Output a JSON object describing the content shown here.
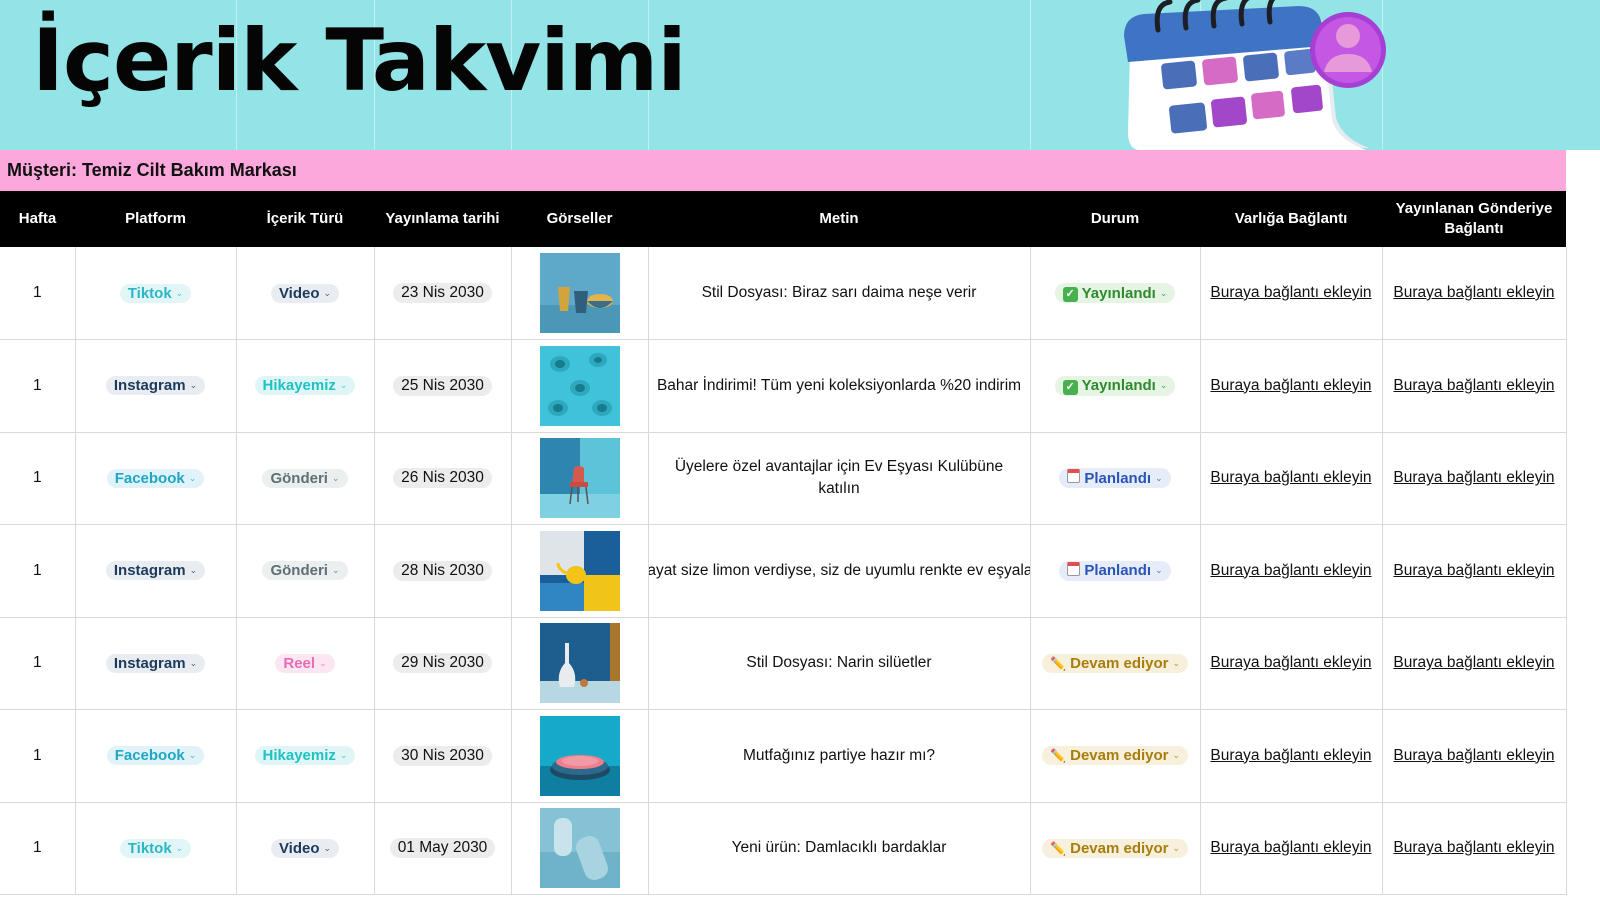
{
  "header": {
    "title": "İçerik Takvimi"
  },
  "client": {
    "label": "Müşteri: Temiz Cilt Bakım Markası"
  },
  "columns": [
    "Hafta",
    "Platform",
    "İçerik Türü",
    "Yayınlama tarihi",
    "Görseller",
    "Metin",
    "Durum",
    "Varlığa Bağlantı",
    "Yayınlanan Gönderiye Bağlantı"
  ],
  "colors": {
    "header_bg": "#93e4e6",
    "client_bg": "#fca8dd",
    "table_head_bg": "#000000",
    "tiktok": "#2bb7c4",
    "instagram": "#1b3a5c",
    "facebook": "#1ea7c4",
    "video": "#1b3a5c",
    "hikayemiz": "#1ec1c4",
    "gonderi": "#5f6f75",
    "reel": "#e86db7",
    "published": "#2f8a2f",
    "planned": "#2a55b8",
    "in_progress": "#a87d0c"
  },
  "rows": [
    {
      "week": "1",
      "platform": "Tiktok",
      "type": "Video",
      "date": "23 Nis 2030",
      "image": "cups-yellow-blue",
      "text": "Stil Dosyası: Biraz sarı daima neşe verir",
      "status": "Yayınlandı",
      "status_icon": "check-icon",
      "asset_link": "Buraya bağlantı ekleyin",
      "post_link": "Buraya bağlantı ekleyin"
    },
    {
      "week": "1",
      "platform": "Instagram",
      "type": "Hikayemiz",
      "date": "25 Nis 2030",
      "image": "teal-cups-on-blue",
      "text": "Bahar İndirimi! Tüm yeni koleksiyonlarda %20 indirim",
      "status": "Yayınlandı",
      "status_icon": "check-icon",
      "asset_link": "Buraya bağlantı ekleyin",
      "post_link": "Buraya bağlantı ekleyin"
    },
    {
      "week": "1",
      "platform": "Facebook",
      "type": "Gönderi",
      "date": "26 Nis 2030",
      "image": "red-chair-blue-room",
      "text": "Üyelere özel avantajlar için Ev Eşyası Kulübüne katılın",
      "status": "Planlandı",
      "status_icon": "calendar-icon",
      "asset_link": "Buraya bağlantı ekleyin",
      "post_link": "Buraya bağlantı ekleyin"
    },
    {
      "week": "1",
      "platform": "Instagram",
      "type": "Gönderi",
      "date": "28 Nis 2030",
      "image": "yellow-teapot",
      "text": "Hayat size limon verdiyse, siz de uyumlu renkte ev eşyaları",
      "status": "Planlandı",
      "status_icon": "calendar-icon",
      "asset_link": "Buraya bağlantı ekleyin",
      "post_link": "Buraya bağlantı ekleyin"
    },
    {
      "week": "1",
      "platform": "Instagram",
      "type": "Reel",
      "date": "29 Nis 2030",
      "image": "white-vase",
      "text": "Stil Dosyası: Narin silüetler",
      "status": "Devam ediyor",
      "status_icon": "pencil-icon",
      "asset_link": "Buraya bağlantı ekleyin",
      "post_link": "Buraya bağlantı ekleyin"
    },
    {
      "week": "1",
      "platform": "Facebook",
      "type": "Hikayemiz",
      "date": "30 Nis 2030",
      "image": "pink-plates",
      "text": "Mutfağınız partiye hazır mı?",
      "status": "Devam ediyor",
      "status_icon": "pencil-icon",
      "asset_link": "Buraya bağlantı ekleyin",
      "post_link": "Buraya bağlantı ekleyin"
    },
    {
      "week": "1",
      "platform": "Tiktok",
      "type": "Video",
      "date": "01 May 2030",
      "image": "drip-cups",
      "text": "Yeni ürün: Damlacıklı bardaklar",
      "status": "Devam ediyor",
      "status_icon": "pencil-icon",
      "asset_link": "Buraya bağlantı ekleyin",
      "post_link": "Buraya bağlantı ekleyin"
    }
  ]
}
